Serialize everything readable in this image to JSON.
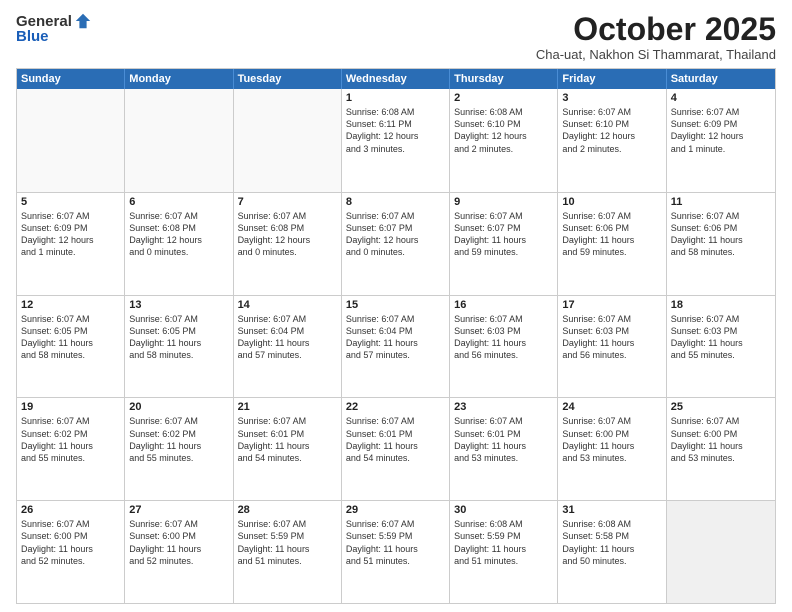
{
  "logo": {
    "general": "General",
    "blue": "Blue"
  },
  "header": {
    "month": "October 2025",
    "location": "Cha-uat, Nakhon Si Thammarat, Thailand"
  },
  "weekdays": [
    "Sunday",
    "Monday",
    "Tuesday",
    "Wednesday",
    "Thursday",
    "Friday",
    "Saturday"
  ],
  "weeks": [
    [
      {
        "day": "",
        "info": "",
        "empty": true
      },
      {
        "day": "",
        "info": "",
        "empty": true
      },
      {
        "day": "",
        "info": "",
        "empty": true
      },
      {
        "day": "1",
        "info": "Sunrise: 6:08 AM\nSunset: 6:11 PM\nDaylight: 12 hours\nand 3 minutes."
      },
      {
        "day": "2",
        "info": "Sunrise: 6:08 AM\nSunset: 6:10 PM\nDaylight: 12 hours\nand 2 minutes."
      },
      {
        "day": "3",
        "info": "Sunrise: 6:07 AM\nSunset: 6:10 PM\nDaylight: 12 hours\nand 2 minutes."
      },
      {
        "day": "4",
        "info": "Sunrise: 6:07 AM\nSunset: 6:09 PM\nDaylight: 12 hours\nand 1 minute."
      }
    ],
    [
      {
        "day": "5",
        "info": "Sunrise: 6:07 AM\nSunset: 6:09 PM\nDaylight: 12 hours\nand 1 minute."
      },
      {
        "day": "6",
        "info": "Sunrise: 6:07 AM\nSunset: 6:08 PM\nDaylight: 12 hours\nand 0 minutes."
      },
      {
        "day": "7",
        "info": "Sunrise: 6:07 AM\nSunset: 6:08 PM\nDaylight: 12 hours\nand 0 minutes."
      },
      {
        "day": "8",
        "info": "Sunrise: 6:07 AM\nSunset: 6:07 PM\nDaylight: 12 hours\nand 0 minutes."
      },
      {
        "day": "9",
        "info": "Sunrise: 6:07 AM\nSunset: 6:07 PM\nDaylight: 11 hours\nand 59 minutes."
      },
      {
        "day": "10",
        "info": "Sunrise: 6:07 AM\nSunset: 6:06 PM\nDaylight: 11 hours\nand 59 minutes."
      },
      {
        "day": "11",
        "info": "Sunrise: 6:07 AM\nSunset: 6:06 PM\nDaylight: 11 hours\nand 58 minutes."
      }
    ],
    [
      {
        "day": "12",
        "info": "Sunrise: 6:07 AM\nSunset: 6:05 PM\nDaylight: 11 hours\nand 58 minutes."
      },
      {
        "day": "13",
        "info": "Sunrise: 6:07 AM\nSunset: 6:05 PM\nDaylight: 11 hours\nand 58 minutes."
      },
      {
        "day": "14",
        "info": "Sunrise: 6:07 AM\nSunset: 6:04 PM\nDaylight: 11 hours\nand 57 minutes."
      },
      {
        "day": "15",
        "info": "Sunrise: 6:07 AM\nSunset: 6:04 PM\nDaylight: 11 hours\nand 57 minutes."
      },
      {
        "day": "16",
        "info": "Sunrise: 6:07 AM\nSunset: 6:03 PM\nDaylight: 11 hours\nand 56 minutes."
      },
      {
        "day": "17",
        "info": "Sunrise: 6:07 AM\nSunset: 6:03 PM\nDaylight: 11 hours\nand 56 minutes."
      },
      {
        "day": "18",
        "info": "Sunrise: 6:07 AM\nSunset: 6:03 PM\nDaylight: 11 hours\nand 55 minutes."
      }
    ],
    [
      {
        "day": "19",
        "info": "Sunrise: 6:07 AM\nSunset: 6:02 PM\nDaylight: 11 hours\nand 55 minutes."
      },
      {
        "day": "20",
        "info": "Sunrise: 6:07 AM\nSunset: 6:02 PM\nDaylight: 11 hours\nand 55 minutes."
      },
      {
        "day": "21",
        "info": "Sunrise: 6:07 AM\nSunset: 6:01 PM\nDaylight: 11 hours\nand 54 minutes."
      },
      {
        "day": "22",
        "info": "Sunrise: 6:07 AM\nSunset: 6:01 PM\nDaylight: 11 hours\nand 54 minutes."
      },
      {
        "day": "23",
        "info": "Sunrise: 6:07 AM\nSunset: 6:01 PM\nDaylight: 11 hours\nand 53 minutes."
      },
      {
        "day": "24",
        "info": "Sunrise: 6:07 AM\nSunset: 6:00 PM\nDaylight: 11 hours\nand 53 minutes."
      },
      {
        "day": "25",
        "info": "Sunrise: 6:07 AM\nSunset: 6:00 PM\nDaylight: 11 hours\nand 53 minutes."
      }
    ],
    [
      {
        "day": "26",
        "info": "Sunrise: 6:07 AM\nSunset: 6:00 PM\nDaylight: 11 hours\nand 52 minutes."
      },
      {
        "day": "27",
        "info": "Sunrise: 6:07 AM\nSunset: 6:00 PM\nDaylight: 11 hours\nand 52 minutes."
      },
      {
        "day": "28",
        "info": "Sunrise: 6:07 AM\nSunset: 5:59 PM\nDaylight: 11 hours\nand 51 minutes."
      },
      {
        "day": "29",
        "info": "Sunrise: 6:07 AM\nSunset: 5:59 PM\nDaylight: 11 hours\nand 51 minutes."
      },
      {
        "day": "30",
        "info": "Sunrise: 6:08 AM\nSunset: 5:59 PM\nDaylight: 11 hours\nand 51 minutes."
      },
      {
        "day": "31",
        "info": "Sunrise: 6:08 AM\nSunset: 5:58 PM\nDaylight: 11 hours\nand 50 minutes."
      },
      {
        "day": "",
        "info": "",
        "empty": true,
        "shaded": true
      }
    ]
  ]
}
